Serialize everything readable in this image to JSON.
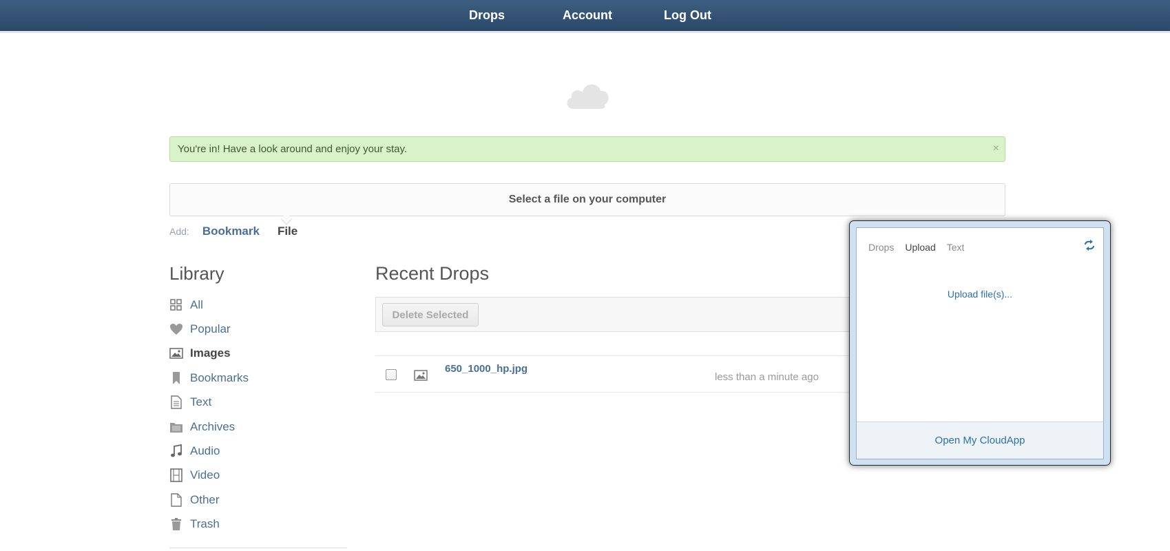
{
  "nav": {
    "drops": "Drops",
    "account": "Account",
    "logout": "Log Out"
  },
  "logo": {
    "icon": "cloud-icon"
  },
  "alert": {
    "message": "You're in! Have a look around and enjoy your stay.",
    "close": "×"
  },
  "upload": {
    "label": "Select a file on your computer"
  },
  "add": {
    "label": "Add:",
    "bookmark": "Bookmark",
    "file": "File"
  },
  "library": {
    "title": "Library",
    "items": [
      {
        "label": "All",
        "icon": "grid-icon"
      },
      {
        "label": "Popular",
        "icon": "heart-icon"
      },
      {
        "label": "Images",
        "icon": "image-icon",
        "active": true
      },
      {
        "label": "Bookmarks",
        "icon": "bookmark-icon"
      },
      {
        "label": "Text",
        "icon": "document-icon"
      },
      {
        "label": "Archives",
        "icon": "archive-icon"
      },
      {
        "label": "Audio",
        "icon": "music-note-icon"
      },
      {
        "label": "Video",
        "icon": "film-icon"
      },
      {
        "label": "Other",
        "icon": "file-icon"
      },
      {
        "label": "Trash",
        "icon": "trash-icon"
      }
    ]
  },
  "recent": {
    "title": "Recent Drops",
    "delete_button": "Delete Selected",
    "rows": [
      {
        "name": "650_1000_hp.jpg",
        "time": "less than a minute ago"
      }
    ]
  },
  "popup": {
    "tabs": [
      {
        "label": "Drops"
      },
      {
        "label": "Upload",
        "active": true
      },
      {
        "label": "Text"
      }
    ],
    "upload_link": "Upload file(s)...",
    "footer": "Open My CloudApp"
  },
  "colors": {
    "topbar": "#2f4e70",
    "link": "#4a6f95",
    "alert_bg": "#d9f2c9",
    "popup_link": "#2a6fb3"
  }
}
